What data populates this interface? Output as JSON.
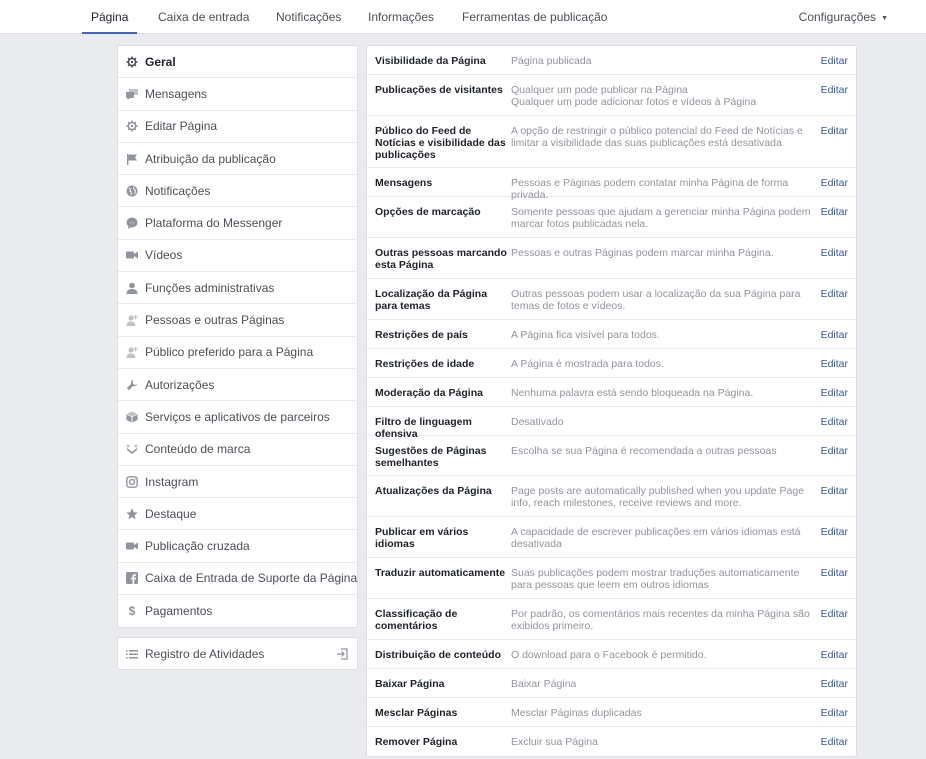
{
  "nav": {
    "tabs": [
      "Página",
      "Caixa de entrada",
      "Notificações",
      "Informações",
      "Ferramentas de publicação"
    ],
    "settings_label": "Configurações"
  },
  "sidebar": {
    "items": [
      {
        "label": "Geral",
        "icon": "gear-icon"
      },
      {
        "label": "Mensagens",
        "icon": "messages-icon"
      },
      {
        "label": "Editar Página",
        "icon": "gear-icon"
      },
      {
        "label": "Atribuição da publicação",
        "icon": "flag-icon"
      },
      {
        "label": "Notificações",
        "icon": "globe-icon"
      },
      {
        "label": "Plataforma do Messenger",
        "icon": "messenger-icon"
      },
      {
        "label": "Vídeos",
        "icon": "video-camera-icon"
      },
      {
        "label": "Funções administrativas",
        "icon": "person-icon"
      },
      {
        "label": "Pessoas e outras Páginas",
        "icon": "person-plus-icon"
      },
      {
        "label": "Público preferido para a Página",
        "icon": "person-plus-icon"
      },
      {
        "label": "Autorizações",
        "icon": "wrench-icon"
      },
      {
        "label": "Serviços e aplicativos de parceiros",
        "icon": "cube-icon"
      },
      {
        "label": "Conteúdo de marca",
        "icon": "handshake-icon"
      },
      {
        "label": "Instagram",
        "icon": "instagram-icon"
      },
      {
        "label": "Destaque",
        "icon": "star-icon"
      },
      {
        "label": "Publicação cruzada",
        "icon": "video-camera-icon"
      },
      {
        "label": "Caixa de Entrada de Suporte da Página",
        "icon": "facebook-icon"
      },
      {
        "label": "Pagamentos",
        "icon": "dollar-icon"
      }
    ],
    "activity_log": "Registro de Atividades"
  },
  "settings": {
    "edit_label": "Editar",
    "rows": [
      {
        "label": "Visibilidade da Página",
        "value": "Página publicada"
      },
      {
        "label": "Publicações de visitantes",
        "value": "Qualquer um pode publicar na Página\nQualquer um pode adicionar fotos e vídeos à Página"
      },
      {
        "label": "Público do Feed de Notícias e visibilidade das publicações",
        "value": "A opção de restringir o público potencial do Feed de Notícias e limitar a visibilidade das suas publicações está desativada"
      },
      {
        "label": "Mensagens",
        "value": "Pessoas e Páginas podem contatar minha Página de forma privada."
      },
      {
        "label": "Opções de marcação",
        "value": "Somente pessoas que ajudam a gerenciar minha Página podem marcar fotos publicadas nela."
      },
      {
        "label": "Outras pessoas marcando esta Página",
        "value": "Pessoas e outras Páginas podem marcar minha Página."
      },
      {
        "label": "Localização da Página para temas",
        "value": "Outras pessoas podem usar a localização da sua Página para temas de fotos e vídeos."
      },
      {
        "label": "Restrições de país",
        "value": "A Página fica visível para todos."
      },
      {
        "label": "Restrições de idade",
        "value": "A Página é mostrada para todos."
      },
      {
        "label": "Moderação da Página",
        "value": "Nenhuma palavra está sendo bloqueada na Página."
      },
      {
        "label": "Filtro de linguagem ofensiva",
        "value": "Desativado"
      },
      {
        "label": "Sugestões de Páginas semelhantes",
        "value": "Escolha se sua Página é recomendada a outras pessoas"
      },
      {
        "label": "Atualizações da Página",
        "value": "Page posts are automatically published when you update Page info, reach milestones, receive reviews and more."
      },
      {
        "label": "Publicar em vários idiomas",
        "value": "A capacidade de escrever publicações em vários idiomas está desativada"
      },
      {
        "label": "Traduzir automaticamente",
        "value": "Suas publicações podem mostrar traduções automaticamente para pessoas que leem em outros idiomas"
      },
      {
        "label": "Classificação de comentários",
        "value": "Por padrão, os comentários mais recentes da minha Página são exibidos primeiro."
      },
      {
        "label": "Distribuição de conteúdo",
        "value": "O download para o Facebook é permitido."
      },
      {
        "label": "Baixar Página",
        "value": "Baixar Página"
      },
      {
        "label": "Mesclar Páginas",
        "value": "Mesclar Páginas duplicadas"
      },
      {
        "label": "Remover Página",
        "value": "Excluir sua Página"
      }
    ]
  },
  "colors": {
    "accent": "#4267b2",
    "link": "#365899",
    "background": "#e9ebee"
  }
}
